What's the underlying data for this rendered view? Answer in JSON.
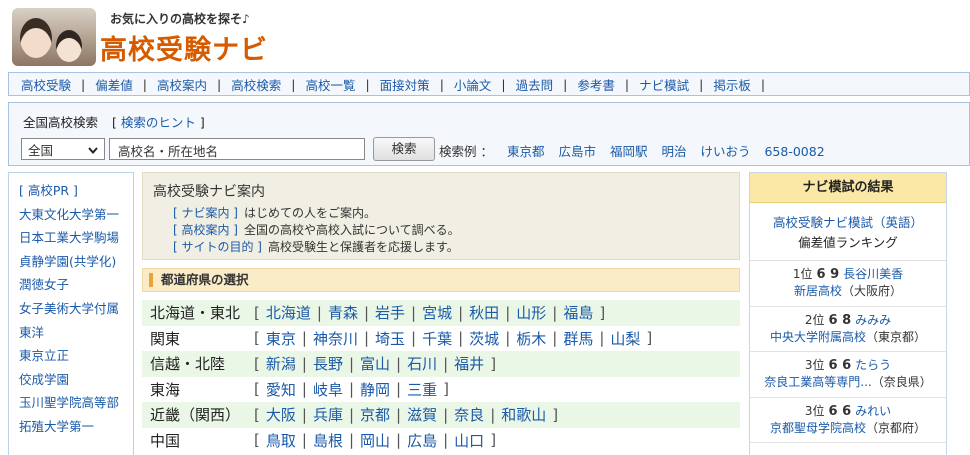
{
  "header": {
    "tagline": "お気に入りの高校を探そ♪",
    "title": "高校受験ナビ"
  },
  "nav": [
    "高校受験",
    "偏差値",
    "高校案内",
    "高校検索",
    "高校一覧",
    "面接対策",
    "小論文",
    "過去問",
    "参考書",
    "ナビ模試",
    "掲示板"
  ],
  "search": {
    "label": "全国高校検索",
    "hint_open": "[",
    "hint": "検索のヒント",
    "hint_close": "]",
    "select_value": "全国",
    "input_value": "高校名・所在地名",
    "button": "検索",
    "examples_label": "検索例 ：",
    "examples": [
      "東京都",
      "広島市",
      "福岡駅",
      "明治",
      "けいおう",
      "658-0082"
    ]
  },
  "sidebar": {
    "items": [
      "[ 高校PR ]",
      "大東文化大学第一",
      "日本工業大学駒場",
      "貞静学園(共学化)",
      "潤徳女子",
      "女子美術大学付属",
      "東洋",
      "東京立正",
      "佼成学園",
      "玉川聖学院高等部",
      "拓殖大学第一"
    ]
  },
  "guide": {
    "title": "高校受験ナビ案内",
    "links": [
      {
        "label": "[ ナビ案内 ]",
        "desc": "はじめての人をご案内。"
      },
      {
        "label": "[ 高校案内 ]",
        "desc": "全国の高校や高校入試について調べる。"
      },
      {
        "label": "[ サイトの目的 ]",
        "desc": "高校受験生と保護者を応援します。"
      }
    ]
  },
  "prefecture_section": {
    "title": "都道府県の選択",
    "regions": [
      {
        "name": "北海道・東北",
        "prefs": [
          "北海道",
          "青森",
          "岩手",
          "宮城",
          "秋田",
          "山形",
          "福島"
        ]
      },
      {
        "name": "関東",
        "prefs": [
          "東京",
          "神奈川",
          "埼玉",
          "千葉",
          "茨城",
          "栃木",
          "群馬",
          "山梨"
        ]
      },
      {
        "name": "信越・北陸",
        "prefs": [
          "新潟",
          "長野",
          "富山",
          "石川",
          "福井"
        ]
      },
      {
        "name": "東海",
        "prefs": [
          "愛知",
          "岐阜",
          "静岡",
          "三重"
        ]
      },
      {
        "name": "近畿（関西）",
        "prefs": [
          "大阪",
          "兵庫",
          "京都",
          "滋賀",
          "奈良",
          "和歌山"
        ]
      },
      {
        "name": "中国",
        "prefs": [
          "鳥取",
          "島根",
          "岡山",
          "広島",
          "山口"
        ]
      }
    ]
  },
  "mock_exam": {
    "header": "ナビ模試の結果",
    "intro_link": "高校受験ナビ模試（英語）",
    "intro_sub": "偏差値ランキング",
    "ranks": [
      {
        "pos": "1位",
        "score": "6 9",
        "name": "長谷川美香",
        "school": "新居高校",
        "loc": "（大阪府）"
      },
      {
        "pos": "2位",
        "score": "6 8",
        "name": "みみみ",
        "school": "中央大学附属高校",
        "loc": "（東京都）"
      },
      {
        "pos": "3位",
        "score": "6 6",
        "name": "たらう",
        "school": "奈良工業高等専門...",
        "loc": "（奈良県）"
      },
      {
        "pos": "3位",
        "score": "6 6",
        "name": "みれい",
        "school": "京都聖母学院高校",
        "loc": "（京都府）"
      }
    ]
  },
  "colors": {
    "title": "#d65a00",
    "link": "#1a5aa8",
    "region_stripe": "#eaf6e6",
    "mock_header": "#fbe8a6",
    "section_header": "#fbecc8"
  }
}
